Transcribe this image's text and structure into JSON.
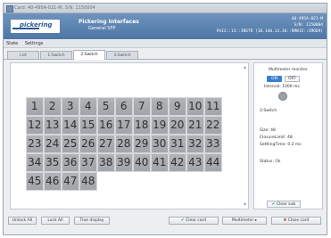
{
  "window": {
    "title": "Card: 40-495A-021-M, S/N: 1150004"
  },
  "header": {
    "logo_text": "pickering",
    "product_line1": "Pickering Interfaces",
    "product_line2": "General SFP",
    "model": "40-495A-021-M",
    "serial": "S/N: 1150004",
    "resource": "PXI2::13::INSTR (10.140.13.36::RM015::CMOD9)"
  },
  "menu": [
    "State",
    "Settings"
  ],
  "tabs": [
    "List",
    "1:Switch",
    "2:Switch",
    "3:Switch"
  ],
  "active_tab": "2:Switch",
  "switch_grid": {
    "cells": [
      "1",
      "2",
      "3",
      "4",
      "5",
      "6",
      "7",
      "8",
      "9",
      "10",
      "11",
      "12",
      "13",
      "14",
      "15",
      "16",
      "17",
      "18",
      "19",
      "20",
      "21",
      "22",
      "23",
      "24",
      "25",
      "26",
      "27",
      "28",
      "29",
      "30",
      "31",
      "32",
      "33",
      "34",
      "35",
      "36",
      "37",
      "38",
      "39",
      "40",
      "41",
      "42",
      "43",
      "44",
      "45",
      "46",
      "47",
      "48"
    ]
  },
  "sidebar": {
    "monitor_title": "Multimeter monitor",
    "on_label": "ON",
    "off_label": "OFF",
    "interval_label": "Interval: 1000 ms",
    "switch_label": "2:Switch",
    "size": "Size: 48",
    "closure_limit": "ClosureLimit: 48",
    "settling_time": "SettlingTime: 0.2 ms",
    "status": "Status: Ok",
    "clear_button": "Clear sub"
  },
  "footer": {
    "unlock_all": "Unlock All",
    "lock_all": "Lock All",
    "true_display": "True display",
    "clear_card": "Clear card",
    "multimeter": "Multimeter",
    "close_card": "Close card"
  },
  "colors": {
    "header_blue": "#5a82b0",
    "accent_on": "#3a7fd0",
    "cell_gray": "#a8abaf"
  },
  "icons": {
    "clear_card": "green-check-icon",
    "close_card": "red-x-icon",
    "multimeter": "dropdown-arrow-icon"
  }
}
